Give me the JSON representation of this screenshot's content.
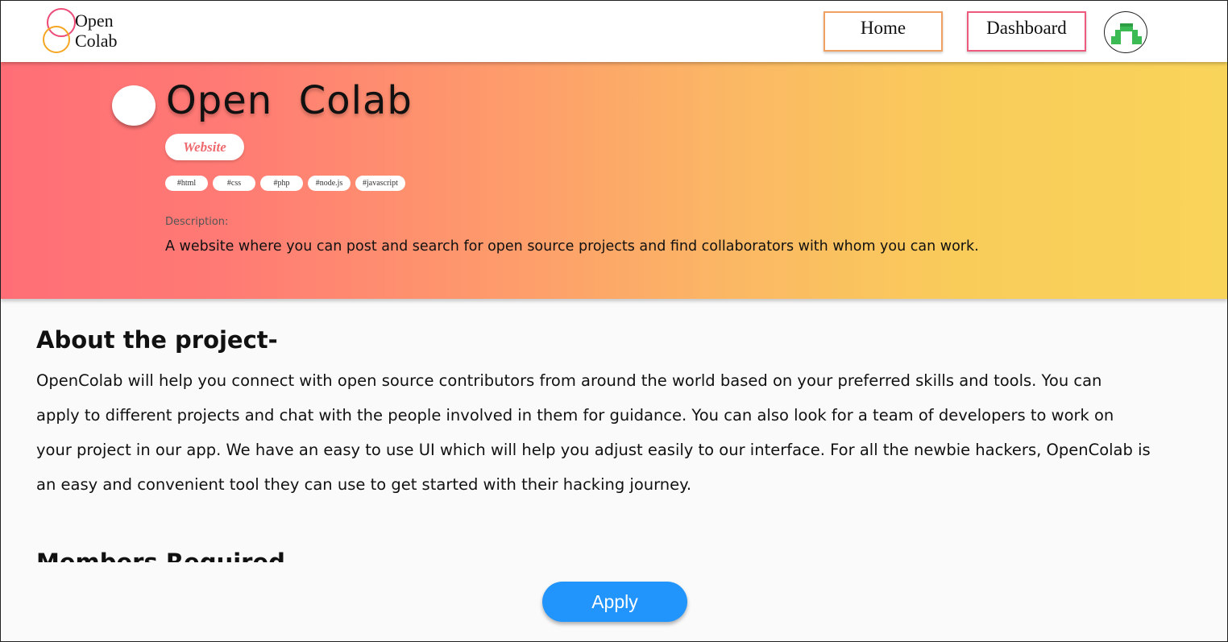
{
  "header": {
    "logo": {
      "line1": "Open",
      "line2": "Colab"
    },
    "nav": {
      "home_label": "Home",
      "dashboard_label": "Dashboard"
    },
    "avatar_icon": "green-pixel-avatar-icon"
  },
  "project": {
    "title": "Open  Colab",
    "type": "Website",
    "tags": [
      "#html",
      "#css",
      "#php",
      "#node.js",
      "#javascript"
    ],
    "description_label": "Description:",
    "description": "A website where you can post and search for open source projects and find collaborators with whom you can work."
  },
  "about": {
    "heading": "About the project-",
    "text": "OpenColab will help you connect with open source contributors from around the world based on your preferred skills and tools. You    can\napply to different projects and chat with the people involved in them for guidance. You can also look for a team of developers to  work on\nyour project in our app. We have an easy to use UI which will help you adjust easily to our interface. For all the newbie hackers, OpenColab is\nan easy and convenient tool they can use to get started with their hacking journey."
  },
  "members": {
    "heading": "Members Required"
  },
  "actions": {
    "apply_label": "Apply"
  },
  "colors": {
    "gradient_start": "#ff6e76",
    "gradient_end": "#f9d45a",
    "apply_button": "#2295fc",
    "home_border": "#f0a060",
    "dashboard_border": "#ec5a7e",
    "website_pill_text": "#ef6a6e"
  }
}
